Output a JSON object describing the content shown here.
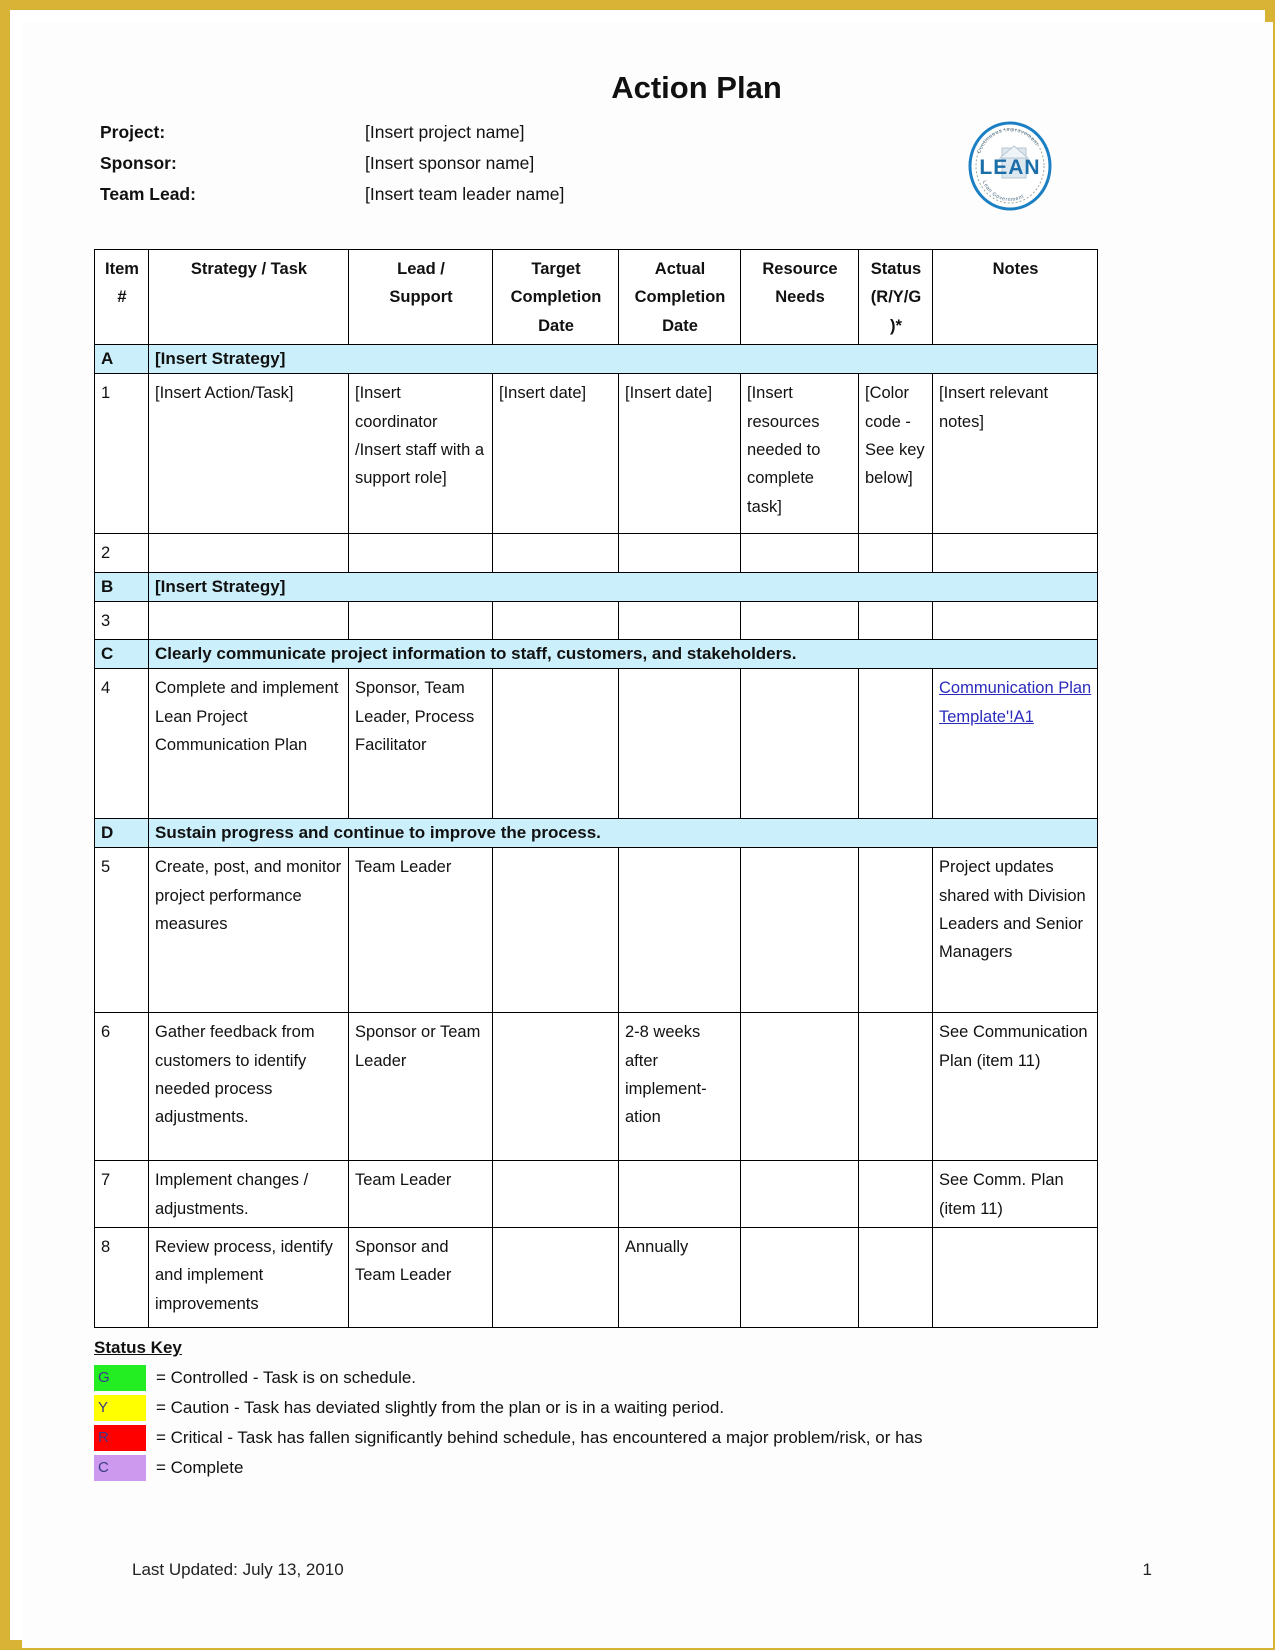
{
  "document": {
    "title": "Action Plan",
    "logo_alt": "LEAN seal logo",
    "logo_center_text": "LEAN",
    "logo_ring_text_top": "Continuous Improvement",
    "logo_ring_text_bottom": "Lean Government"
  },
  "meta": {
    "rows": [
      {
        "label": "Project:",
        "value": "[Insert project name]"
      },
      {
        "label": "Sponsor:",
        "value": "[Insert sponsor name]"
      },
      {
        "label": "Team Lead:",
        "value": "[Insert team leader name]"
      }
    ]
  },
  "table": {
    "headers": [
      "Item #",
      "Strategy / Task",
      "Lead / Support",
      "Target Completion Date",
      "Actual Completion Date",
      "Resource Needs",
      "Status (R/Y/G )*",
      "Notes"
    ],
    "headers_split": {
      "item": [
        "Item",
        "#"
      ],
      "task": [
        "Strategy / Task"
      ],
      "lead": [
        "Lead /",
        "Support"
      ],
      "target": [
        "Target",
        "Completion",
        "Date"
      ],
      "actual": [
        "Actual",
        "Completion",
        "Date"
      ],
      "resource": [
        "Resource",
        "Needs"
      ],
      "status": [
        "Status",
        "(R/Y/G",
        ")*"
      ],
      "notes": [
        "Notes"
      ]
    },
    "sections": [
      {
        "letter": "A",
        "title": "[Insert Strategy]",
        "rows": [
          {
            "item": "1",
            "task": "[Insert Action/Task]",
            "lead": "[Insert coordinator /Insert staff with a support role]",
            "target": "[Insert date]",
            "actual": "[Insert date]",
            "resource": "[Insert resources needed to complete task]",
            "status": "[Color code - See key below]",
            "notes": "[Insert relevant notes]",
            "notes_is_link": false
          },
          {
            "item": "2",
            "task": "",
            "lead": "",
            "target": "",
            "actual": "",
            "resource": "",
            "status": "",
            "notes": "",
            "notes_is_link": false
          }
        ]
      },
      {
        "letter": "B",
        "title": "[Insert Strategy]",
        "rows": [
          {
            "item": "3",
            "task": "",
            "lead": "",
            "target": "",
            "actual": "",
            "resource": "",
            "status": "",
            "notes": "",
            "notes_is_link": false
          }
        ]
      },
      {
        "letter": "C",
        "title": "Clearly communicate project information to staff, customers, and stakeholders.",
        "rows": [
          {
            "item": "4",
            "task": "Complete and implement Lean Project Communication Plan",
            "lead": "Sponsor, Team Leader, Process Facilitator",
            "target": "",
            "actual": "",
            "resource": "",
            "status": "",
            "notes": "Communication Plan Template'!A1",
            "notes_is_link": true
          }
        ]
      },
      {
        "letter": "D",
        "title": "Sustain progress and continue to improve the process.",
        "rows": [
          {
            "item": "5",
            "task": "Create, post, and monitor project performance measures",
            "lead": "Team Leader",
            "target": "",
            "actual": "",
            "resource": "",
            "status": "",
            "notes": "Project updates shared with Division Leaders and Senior Managers",
            "notes_is_link": false
          },
          {
            "item": "6",
            "task": "Gather feedback from customers to identify needed process adjustments.",
            "lead": "Sponsor or Team Leader",
            "target": "",
            "actual": "2-8 weeks after implement-ation",
            "resource": "",
            "status": "",
            "notes": "See Communication Plan (item 11)",
            "notes_is_link": false
          },
          {
            "item": "7",
            "task": "Implement changes / adjustments.",
            "lead": "Team Leader",
            "target": "",
            "actual": "",
            "resource": "",
            "status": "",
            "notes": "See Comm. Plan (item 11)",
            "notes_is_link": false
          },
          {
            "item": "8",
            "task": "Review process, identify and implement improvements",
            "lead": "Sponsor and Team Leader",
            "target": "",
            "actual": "Annually",
            "resource": "",
            "status": "",
            "notes": "",
            "notes_is_link": false
          }
        ]
      }
    ]
  },
  "status_key": {
    "title": "Status Key",
    "items": [
      {
        "code": "G",
        "color": "#22ee22",
        "text": "= Controlled - Task is on schedule."
      },
      {
        "code": "Y",
        "color": "#ffff00",
        "text": "= Caution - Task has deviated slightly from the plan or is in a waiting period."
      },
      {
        "code": "R",
        "color": "#ff0000",
        "text": "= Critical - Task has fallen significantly behind schedule, has encountered a major problem/risk, or has"
      },
      {
        "code": "C",
        "color": "#cc99ee",
        "text": "= Complete"
      }
    ]
  },
  "footer": {
    "last_updated": "Last Updated: July 13, 2010",
    "page_number": "1"
  },
  "colors": {
    "header_blue": "#1d86d6",
    "section_blue": "#ccf0fb",
    "page_border_gold": "#d8b335",
    "link_blue": "#2b2bbd"
  }
}
